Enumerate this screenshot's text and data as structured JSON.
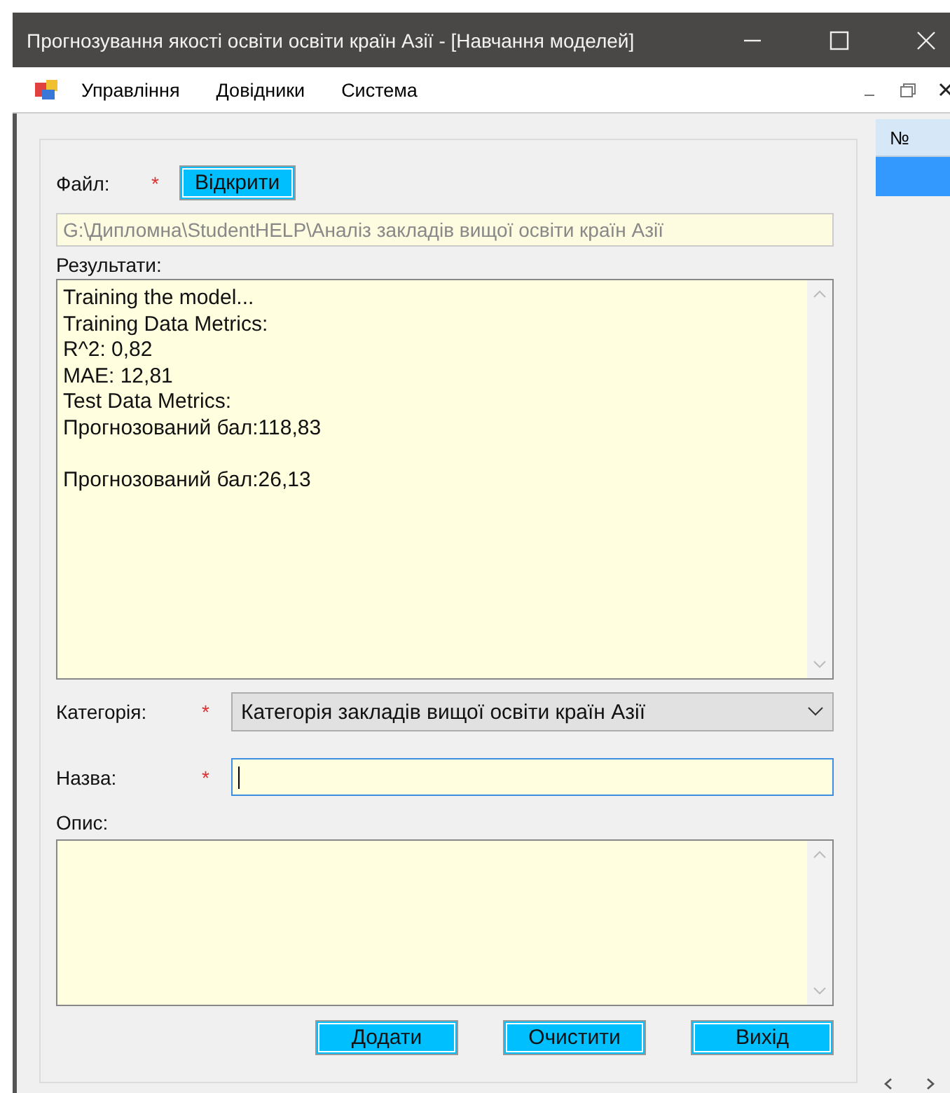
{
  "window": {
    "title": "Прогнозування якості освіти освіти країн Азії - [Навчання моделей]"
  },
  "menu": {
    "items": [
      "Управління",
      "Довідники",
      "Система"
    ]
  },
  "form": {
    "file": {
      "label": "Файл:",
      "required_mark": "*",
      "button": "Відкрити",
      "path": "G:\\Дипломна\\StudentHELP\\Аналіз закладів вищої освіти країн Азії"
    },
    "results": {
      "label": "Результати:",
      "text": "Training the model...\nTraining Data Metrics:\nR^2: 0,82\nMAE: 12,81\nTest Data Metrics:\nПрогнозований бал:118,83\n\nПрогнозований бал:26,13"
    },
    "category": {
      "label": "Категорія:",
      "required_mark": "*",
      "value": "Категорія закладів вищої освіти країн Азії"
    },
    "name": {
      "label": "Назва:",
      "required_mark": "*",
      "focused": true
    },
    "description": {
      "label": "Опис:"
    },
    "buttons": [
      "Додати",
      "Очистити",
      "Вихід"
    ]
  },
  "grid": {
    "header": "№",
    "rows": [
      {
        "selected": true
      }
    ]
  }
}
